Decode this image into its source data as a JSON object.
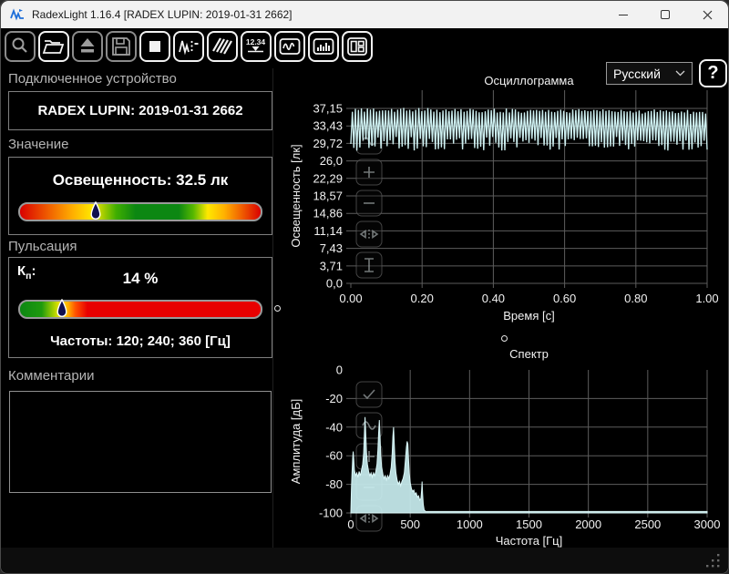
{
  "window": {
    "title": "RadexLight 1.16.4 [RADEX LUPIN: 2019-01-31 2662]"
  },
  "toolbar": {
    "buttons": [
      {
        "name": "zoom-tool-button",
        "icon": "magnifier-icon",
        "disabled": true
      },
      {
        "name": "open-file-button",
        "icon": "open-folder-icon",
        "disabled": false
      },
      {
        "name": "eject-device-button",
        "icon": "eject-icon",
        "disabled": true
      },
      {
        "name": "save-button",
        "icon": "floppy-icon",
        "disabled": true
      },
      {
        "name": "stop-button",
        "icon": "stop-icon",
        "disabled": false
      },
      {
        "name": "measure-signal-button",
        "icon": "signal-peaks-icon",
        "disabled": false
      },
      {
        "name": "hatch-view-button",
        "icon": "diagonal-lines-icon",
        "disabled": false
      },
      {
        "name": "numeric-readout-button",
        "icon": "numeric-readout-icon",
        "disabled": false,
        "label": "12.34"
      },
      {
        "name": "oscillogram-view-button",
        "icon": "waveform-icon",
        "disabled": false
      },
      {
        "name": "spectrum-view-button",
        "icon": "bar-chart-icon",
        "disabled": false
      },
      {
        "name": "layout-view-button",
        "icon": "panels-icon",
        "disabled": false
      }
    ],
    "language_select": {
      "value": "Русский"
    },
    "help_label": "?"
  },
  "left_panel": {
    "device": {
      "label": "Подключенное устройство",
      "name": "RADEX LUPIN: 2019-01-31 2662"
    },
    "value": {
      "label": "Значение",
      "reading": "Освещенность: 32.5 лк",
      "marker_pct": 31.5,
      "gradient": [
        "#d90000 0%",
        "#f06000 12%",
        "#ffb000 22%",
        "#ffe800 30%",
        "#3fae00 40%",
        "#0c8712 48%",
        "#0c8712 66%",
        "#57b800 72%",
        "#ffe800 78%",
        "#ffb000 85%",
        "#f06000 92%",
        "#d90000 100%"
      ]
    },
    "pulsation": {
      "label": "Пульсация",
      "kp_main": "К",
      "kp_sub": "п",
      "kp_colon": ":",
      "value": "14 %",
      "frequencies": "Частоты: 120; 240; 360 [Гц]",
      "marker_pct": 17.5,
      "gradient": [
        "#0c8712 0%",
        "#1f9a0e 9%",
        "#a8d000 14%",
        "#ffe800 17%",
        "#ffb000 20%",
        "#ff5400 23%",
        "#e80000 28%",
        "#e80000 100%"
      ]
    },
    "comments": {
      "label": "Комментарии",
      "text": ""
    }
  },
  "marker_color": "#10104f",
  "chart_data": [
    {
      "type": "line",
      "title": "Осциллограмма",
      "xlabel": "Время [с]",
      "ylabel": "Освещенность [лк]",
      "xlim": [
        0,
        1
      ],
      "ylim": [
        0,
        40.8
      ],
      "x_tick_values": [
        0,
        0.2,
        0.4,
        0.6,
        0.8,
        1.0
      ],
      "x_tick_labels": [
        "0.00",
        "0.20",
        "0.40",
        "0.60",
        "0.80",
        "1.00"
      ],
      "y_tick_values": [
        0,
        3.71,
        7.43,
        11.14,
        14.86,
        18.57,
        22.29,
        26.0,
        29.72,
        33.43,
        37.15
      ],
      "y_tick_labels": [
        "0,0",
        "3,71",
        "7,43",
        "11,14",
        "14,86",
        "18,57",
        "22,29",
        "26,0",
        "29,72",
        "33,43",
        "37,15"
      ],
      "grid": true,
      "trace_color": "#cdeff0",
      "signal": {
        "description": "dense 120 Hz light-flicker waveform, 1 s window",
        "cycles": 118,
        "top_mean": 36.9,
        "top_jitter": 0.45,
        "bottom_mean": 29.6,
        "bottom_jitter": 1.5,
        "trend": -0.5,
        "seed": 987654
      },
      "buttons": [
        "wave-view-icon",
        "zoom-in-icon",
        "zoom-out-icon",
        "fit-x-icon",
        "fit-y-icon"
      ]
    },
    {
      "type": "area",
      "title": "Спектр",
      "xlabel": "Частота [Гц]",
      "ylabel": "Амплитуда [дБ]",
      "xlim": [
        0,
        3000
      ],
      "ylim": [
        -100,
        0
      ],
      "x_tick_values": [
        0,
        500,
        1000,
        1500,
        2000,
        2500,
        3000
      ],
      "x_tick_labels": [
        "0",
        "500",
        "1000",
        "1500",
        "2000",
        "2500",
        "3000"
      ],
      "y_tick_values": [
        0,
        -20,
        -40,
        -60,
        -80,
        -100
      ],
      "y_tick_labels": [
        "0",
        "-20",
        "-40",
        "-60",
        "-80",
        "-100"
      ],
      "grid": true,
      "trace_color": "#c6ebee",
      "points": [
        [
          0,
          -100
        ],
        [
          5,
          -82
        ],
        [
          10,
          -72
        ],
        [
          15,
          -62
        ],
        [
          20,
          -57
        ],
        [
          25,
          -63
        ],
        [
          30,
          -70
        ],
        [
          40,
          -74
        ],
        [
          50,
          -72
        ],
        [
          60,
          -75
        ],
        [
          70,
          -71
        ],
        [
          80,
          -74
        ],
        [
          90,
          -70
        ],
        [
          100,
          -66
        ],
        [
          108,
          -58
        ],
        [
          114,
          -44
        ],
        [
          120,
          -33
        ],
        [
          126,
          -45
        ],
        [
          132,
          -58
        ],
        [
          140,
          -66
        ],
        [
          150,
          -71
        ],
        [
          160,
          -74
        ],
        [
          170,
          -72
        ],
        [
          180,
          -75
        ],
        [
          190,
          -72
        ],
        [
          200,
          -74
        ],
        [
          210,
          -71
        ],
        [
          220,
          -66
        ],
        [
          228,
          -56
        ],
        [
          234,
          -44
        ],
        [
          240,
          -35
        ],
        [
          246,
          -47
        ],
        [
          252,
          -60
        ],
        [
          260,
          -68
        ],
        [
          270,
          -73
        ],
        [
          280,
          -76
        ],
        [
          290,
          -74
        ],
        [
          300,
          -77
        ],
        [
          310,
          -74
        ],
        [
          320,
          -76
        ],
        [
          330,
          -73
        ],
        [
          340,
          -68
        ],
        [
          348,
          -58
        ],
        [
          354,
          -47
        ],
        [
          360,
          -40
        ],
        [
          366,
          -52
        ],
        [
          372,
          -64
        ],
        [
          380,
          -72
        ],
        [
          390,
          -77
        ],
        [
          400,
          -80
        ],
        [
          410,
          -78
        ],
        [
          420,
          -81
        ],
        [
          430,
          -78
        ],
        [
          440,
          -76
        ],
        [
          450,
          -72
        ],
        [
          460,
          -62
        ],
        [
          468,
          -54
        ],
        [
          474,
          -50
        ],
        [
          480,
          -52
        ],
        [
          486,
          -62
        ],
        [
          492,
          -72
        ],
        [
          500,
          -79
        ],
        [
          510,
          -83
        ],
        [
          520,
          -85
        ],
        [
          530,
          -84
        ],
        [
          540,
          -87
        ],
        [
          550,
          -86
        ],
        [
          560,
          -89
        ],
        [
          570,
          -88
        ],
        [
          580,
          -91
        ],
        [
          590,
          -90
        ],
        [
          596,
          -84
        ],
        [
          600,
          -78
        ],
        [
          604,
          -86
        ],
        [
          610,
          -94
        ],
        [
          618,
          -98
        ],
        [
          630,
          -99
        ],
        [
          700,
          -99
        ],
        [
          1000,
          -99
        ],
        [
          1500,
          -99
        ],
        [
          2000,
          -99
        ],
        [
          2500,
          -99
        ],
        [
          3000,
          -99
        ]
      ],
      "peak_frequencies_hz": [
        120,
        240,
        360
      ],
      "buttons": [
        "select-check-icon",
        "wave-view-icon",
        "zoom-in-icon",
        "zoom-out-icon",
        "fit-x-icon"
      ]
    }
  ]
}
